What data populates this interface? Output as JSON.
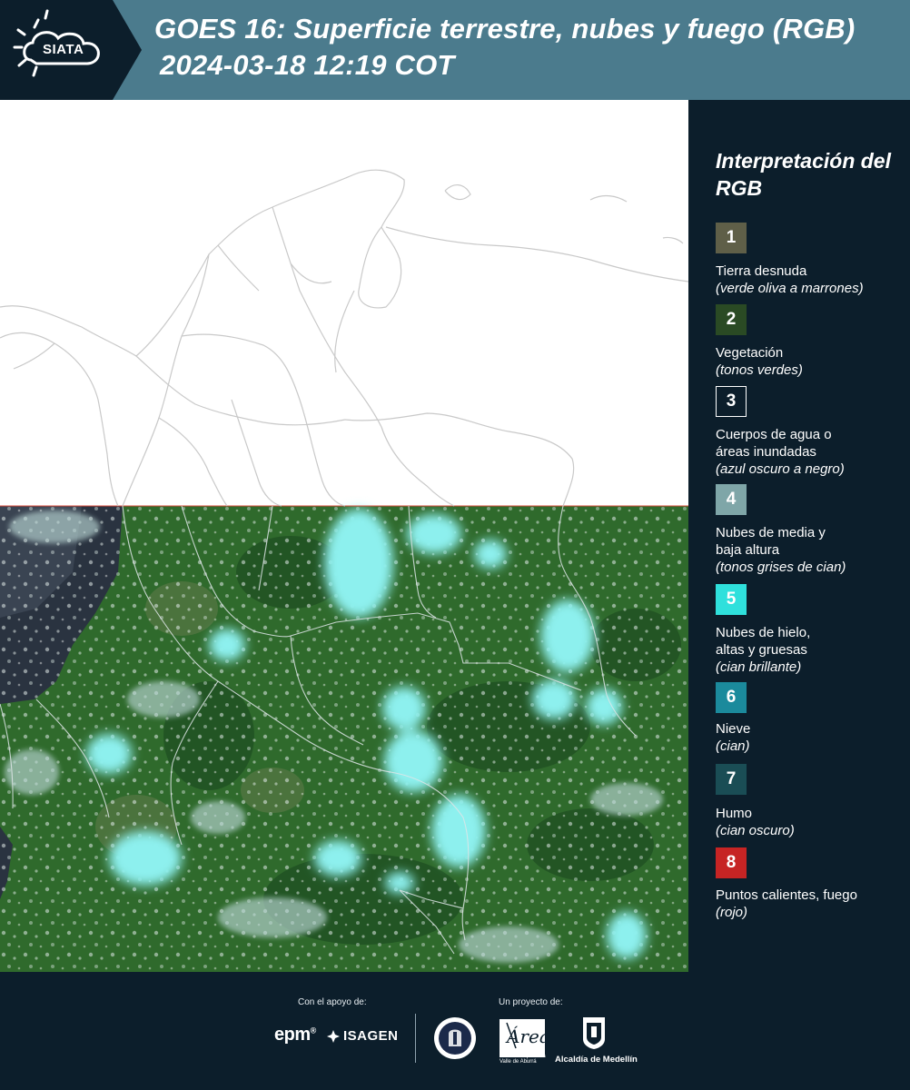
{
  "header": {
    "logo_text": "SIATA",
    "title": "GOES 16: Superficie terrestre, nubes y fuego (RGB)",
    "subtitle": "2024-03-18 12:19 COT"
  },
  "legend": {
    "title": "Interpretación del RGB",
    "items": [
      {
        "number": "1",
        "color": "#5f5f48",
        "name": "Tierra desnuda",
        "note": "(verde oliva a marrones)"
      },
      {
        "number": "2",
        "color": "#2a4a24",
        "name": "Vegetación",
        "note": "(tonos verdes)"
      },
      {
        "number": "3",
        "color": "#0c1e2b",
        "name": "Cuerpos de agua o áreas inundadas",
        "note": "(azul oscuro a negro)"
      },
      {
        "number": "4",
        "color": "#7fa6a8",
        "name": "Nubes de media y baja altura",
        "note": "(tonos grises de cian)"
      },
      {
        "number": "5",
        "color": "#2fe0dc",
        "name": "Nubes de hielo, altas y gruesas",
        "note": "(cian brillante)"
      },
      {
        "number": "6",
        "color": "#1b8a9c",
        "name": "Nieve",
        "note": "(cian)"
      },
      {
        "number": "7",
        "color": "#1a4d55",
        "name": "Humo",
        "note": "(cian oscuro)"
      },
      {
        "number": "8",
        "color": "#c62424",
        "name": "Puntos calientes, fuego",
        "note": "(rojo)"
      }
    ]
  },
  "footer": {
    "support_label": "Con el apoyo de:",
    "project_label": "Un proyecto de:",
    "sponsor_1": "epm",
    "sponsor_2": "ISAGEN",
    "partner_1": "Área Metropolitana Valle de Aburrá",
    "partner_2": "Alcaldía de Medellín"
  },
  "map": {
    "land_color": "#2f6a2c",
    "ocean_color": "#2a3340",
    "cloud_color": "#8df0ee"
  }
}
